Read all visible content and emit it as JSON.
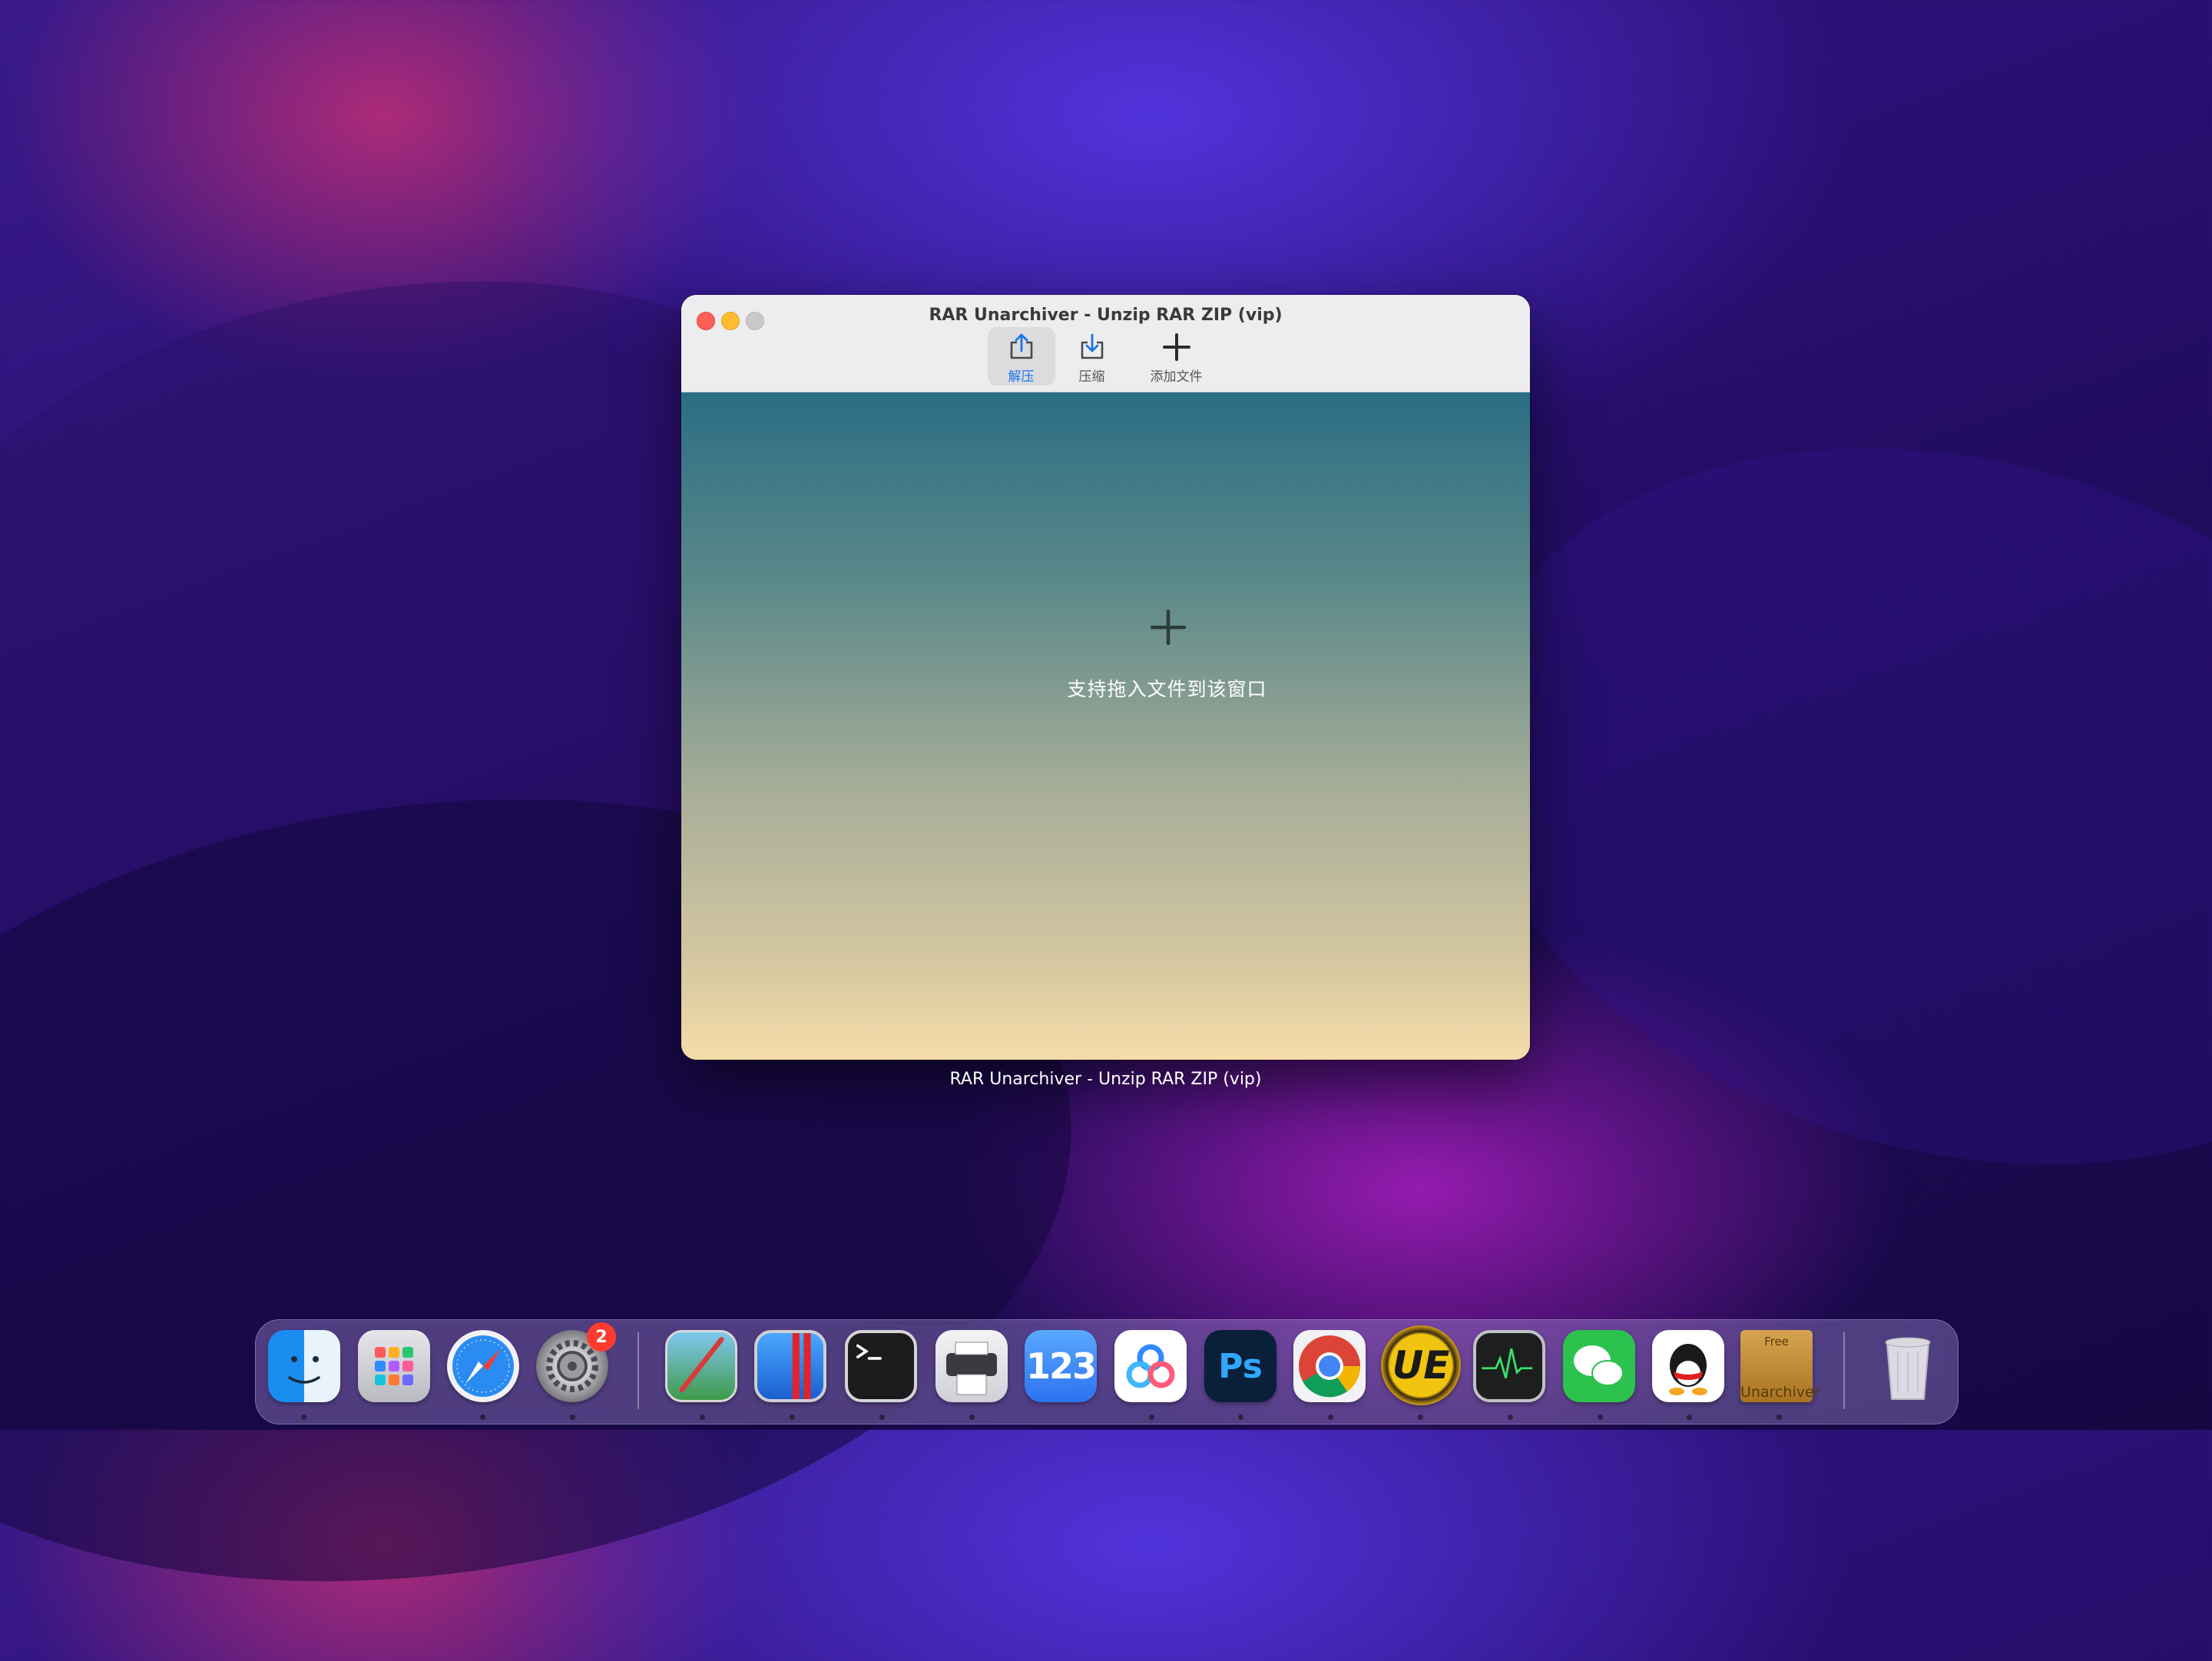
{
  "window": {
    "title": "RAR Unarchiver - Unzip RAR ZIP (vip)",
    "caption": "RAR Unarchiver - Unzip RAR ZIP (vip)",
    "toolbar": [
      {
        "label": "解压",
        "icon": "unarchive-icon",
        "active": true
      },
      {
        "label": "压缩",
        "icon": "archive-icon",
        "active": false
      },
      {
        "label": "添加文件",
        "icon": "plus-icon",
        "active": false
      }
    ],
    "drop_zone": {
      "icon": "plus-icon",
      "text": "支持拖入文件到该窗口"
    }
  },
  "dock": {
    "apps": [
      {
        "name": "Finder",
        "icon": "finder-icon",
        "running": true
      },
      {
        "name": "Launchpad",
        "icon": "launchpad-icon",
        "running": false
      },
      {
        "name": "Safari",
        "icon": "safari-icon",
        "running": true
      },
      {
        "name": "System Preferences",
        "icon": "system-preferences-icon",
        "running": true,
        "badge": "2"
      },
      {
        "name": "Preview",
        "icon": "preview-icon",
        "running": true
      },
      {
        "name": "Parallels Desktop",
        "icon": "parallels-icon",
        "running": true
      },
      {
        "name": "Terminal",
        "icon": "terminal-icon",
        "running": true
      },
      {
        "name": "Printer",
        "icon": "printer-icon",
        "running": true
      },
      {
        "name": "Numbers",
        "icon": "numbers-icon",
        "running": false
      },
      {
        "name": "Baidu Netdisk",
        "icon": "cloud-drive-icon",
        "running": true
      },
      {
        "name": "Photoshop",
        "icon": "photoshop-icon",
        "running": true,
        "text": "Ps"
      },
      {
        "name": "Chrome",
        "icon": "chrome-icon",
        "running": true
      },
      {
        "name": "UltraEdit",
        "icon": "ultraedit-icon",
        "running": true,
        "text": "UE"
      },
      {
        "name": "Activity Monitor",
        "icon": "activity-monitor-icon",
        "running": true
      },
      {
        "name": "WeChat",
        "icon": "wechat-icon",
        "running": true
      },
      {
        "name": "QQ",
        "icon": "qq-icon",
        "running": true
      },
      {
        "name": "Unarchiver",
        "icon": "unarchiver-icon",
        "running": true,
        "text_top": "Free",
        "text": "Unarchiver"
      },
      {
        "name": "Trash",
        "icon": "trash-icon",
        "running": false
      }
    ]
  },
  "colors": {
    "accent": "#1a74e8",
    "badge": "#ff3b30"
  }
}
